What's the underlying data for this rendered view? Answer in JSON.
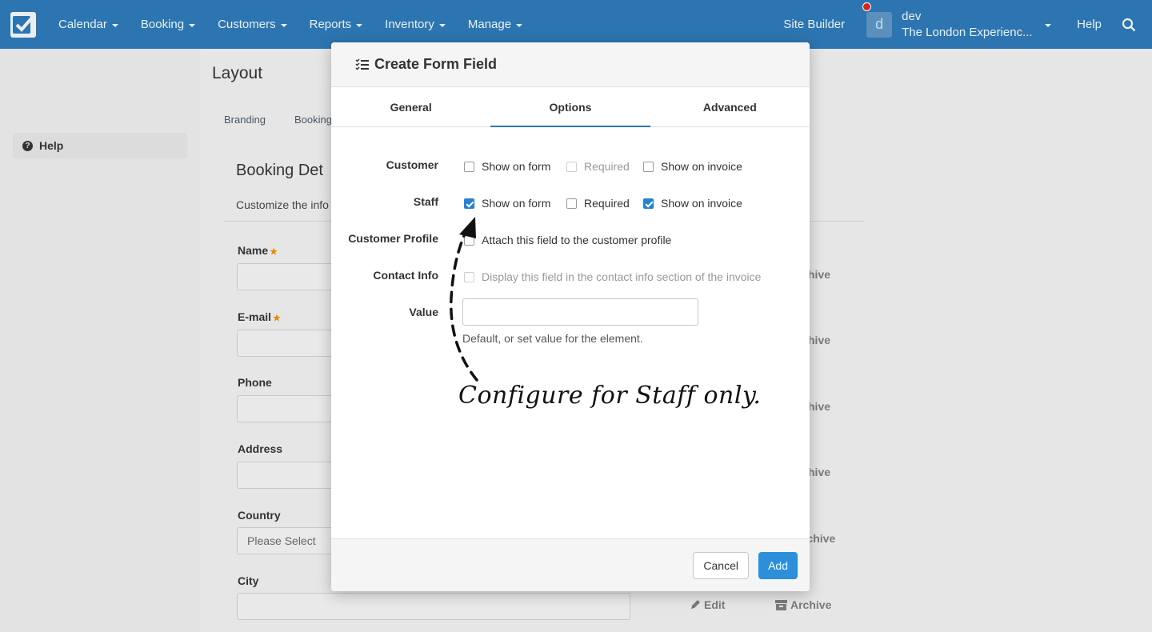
{
  "nav": {
    "items": [
      {
        "label": "Calendar"
      },
      {
        "label": "Booking"
      },
      {
        "label": "Customers"
      },
      {
        "label": "Reports"
      },
      {
        "label": "Inventory"
      },
      {
        "label": "Manage"
      }
    ],
    "site_builder": "Site Builder",
    "user_name": "dev",
    "user_company": "The London Experienc...",
    "avatar_letter": "d",
    "help": "Help",
    "brand_color": "#2d75b0"
  },
  "sidebar": {
    "help": "Help"
  },
  "page": {
    "title": "Layout",
    "tabs": [
      "Branding",
      "Booking"
    ],
    "section_title": "Booking Det",
    "section_subtitle": "Customize the info",
    "fields": [
      {
        "label": "Name",
        "required": true
      },
      {
        "label": "E-mail",
        "required": true
      },
      {
        "label": "Phone",
        "required": false
      },
      {
        "label": "Address",
        "required": false
      },
      {
        "label": "Country",
        "required": false,
        "value": "Please Select"
      },
      {
        "label": "City",
        "required": false
      }
    ],
    "archive_partial": "hive",
    "archive_partial_alt": "rchive",
    "edit": "Edit",
    "archive": "Archive"
  },
  "modal": {
    "title": "Create Form Field",
    "tabs": [
      "General",
      "Options",
      "Advanced"
    ],
    "active_tab": "Options",
    "rows": {
      "customer": {
        "label": "Customer",
        "show_on_form": {
          "label": "Show on form",
          "checked": false
        },
        "required": {
          "label": "Required",
          "checked": false,
          "disabled": true
        },
        "show_on_invoice": {
          "label": "Show on invoice",
          "checked": false
        }
      },
      "staff": {
        "label": "Staff",
        "show_on_form": {
          "label": "Show on form",
          "checked": true
        },
        "required": {
          "label": "Required",
          "checked": false
        },
        "show_on_invoice": {
          "label": "Show on invoice",
          "checked": true
        }
      },
      "customer_profile": {
        "label": "Customer Profile",
        "option": "Attach this field to the customer profile"
      },
      "contact_info": {
        "label": "Contact Info",
        "option": "Display this field in the contact info section of the invoice"
      },
      "value": {
        "label": "Value",
        "input_value": "",
        "help": "Default, or set value for the element."
      }
    },
    "annotation": "Configure for Staff only.",
    "cancel": "Cancel",
    "add": "Add"
  }
}
